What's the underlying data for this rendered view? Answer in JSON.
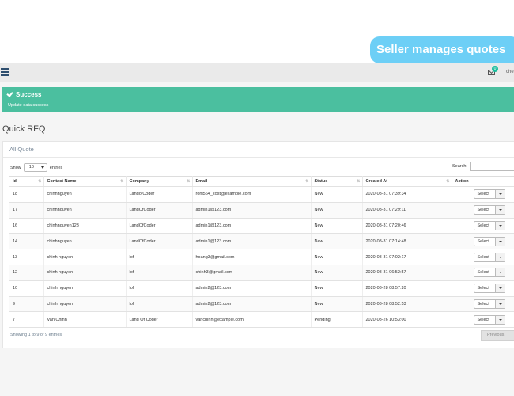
{
  "banner": {
    "text": "Seller manages quotes"
  },
  "topbar": {
    "mail_badge": "0",
    "user_name": "che"
  },
  "alert": {
    "title": "Success",
    "message": "Update data success"
  },
  "page": {
    "title": "Quick RFQ"
  },
  "panel": {
    "heading": "All Quote",
    "show_label": "Show",
    "entries_value": "10",
    "entries_label": "entries",
    "search_label": "Search:",
    "info": "Showing 1 to 9 of 9 entries",
    "previous_label": "Previous"
  },
  "table": {
    "headers": [
      "Id",
      "Contact Name",
      "Company",
      "Email",
      "Status",
      "Created At",
      "Action"
    ],
    "action_label": "Select",
    "rows": [
      [
        "18",
        "chinhnguyen",
        "LandofCoder",
        "roni564_cost@example.com",
        "New",
        "2020-08-31 07:39:34"
      ],
      [
        "17",
        "chinhnguyen",
        "LandOfCoder",
        "admin1@123.com",
        "New",
        "2020-08-31 07:29:11"
      ],
      [
        "16",
        "chinhnguyen123",
        "LandOfCoder",
        "admin1@123.com",
        "New",
        "2020-08-31 07:20:46"
      ],
      [
        "14",
        "chinhnguyen",
        "LandOfCoder",
        "admin1@123.com",
        "New",
        "2020-08-31 07:14:48"
      ],
      [
        "13",
        "chinh nguyen",
        "lof",
        "hoang3@gmail.com",
        "New",
        "2020-08-31 07:02:17"
      ],
      [
        "12",
        "chinh nguyen",
        "lof",
        "chinh3@gmail.com",
        "New",
        "2020-08-31 06:52:57"
      ],
      [
        "10",
        "chinh nguyen",
        "lof",
        "admin2@123.com",
        "New",
        "2020-08-28 08:57:20"
      ],
      [
        "9",
        "chinh nguyen",
        "lof",
        "admin2@123.com",
        "New",
        "2020-08-28 08:52:53"
      ],
      [
        "7",
        "Van Chinh",
        "Land Of Coder",
        "vanchinh@example.com",
        "Pending",
        "2020-08-26 10:53:00"
      ]
    ]
  }
}
